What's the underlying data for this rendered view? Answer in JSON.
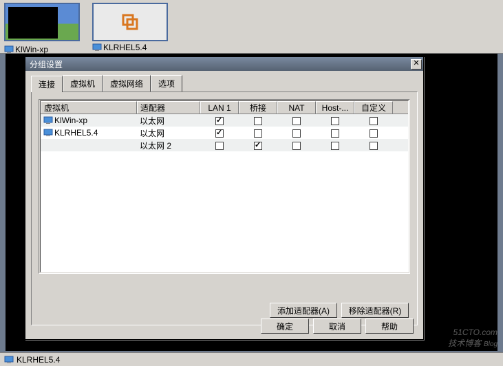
{
  "desktop": {
    "tiles": [
      {
        "label": "KlWin-xp",
        "type": "win"
      },
      {
        "label": "KLRHEL5.4",
        "type": "rhel"
      }
    ]
  },
  "dialog": {
    "title": "分组设置",
    "tabs": {
      "connect": "连接",
      "vm": "虚拟机",
      "vnet": "虚拟网络",
      "options": "选项"
    },
    "columns": {
      "vm": "虚拟机",
      "adapter": "适配器",
      "lan1": "LAN 1",
      "bridge": "桥接",
      "nat": "NAT",
      "hostonly": "Host-...",
      "custom": "自定义"
    },
    "rows": [
      {
        "name": "KlWin-xp",
        "adapter": "以太网",
        "lan1": true,
        "bridge": false,
        "nat": false,
        "hostonly": false,
        "custom": false,
        "icon": true
      },
      {
        "name": "KLRHEL5.4",
        "adapter": "以太网",
        "lan1": true,
        "bridge": false,
        "nat": false,
        "hostonly": false,
        "custom": false,
        "icon": true
      },
      {
        "name": "",
        "adapter": "以太网 2",
        "lan1": false,
        "bridge": true,
        "nat": false,
        "hostonly": false,
        "custom": false,
        "icon": false
      }
    ],
    "buttons": {
      "add_adapter": "添加适配器(A)",
      "remove_adapter": "移除适配器(R)",
      "ok": "确定",
      "cancel": "取消",
      "help": "帮助"
    }
  },
  "statusbar": {
    "label": "KLRHEL5.4"
  },
  "watermark": {
    "line1": "51CTO.com",
    "line2": "技术博客",
    "suffix": "Blog"
  }
}
